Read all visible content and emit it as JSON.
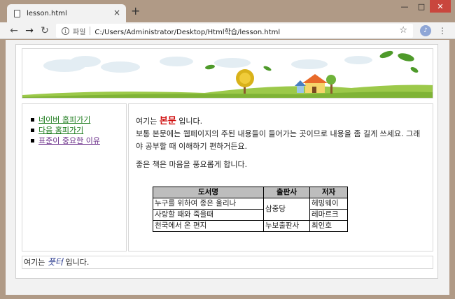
{
  "browser": {
    "tab_title": "lesson.html",
    "new_tab": "+",
    "tab_close": "×",
    "scheme_label": "파일",
    "url": "C:/Users/Administrator/Desktop/Html학습/lesson.html"
  },
  "nav": {
    "items": [
      {
        "label": "네이버 홈피가기",
        "state": "link"
      },
      {
        "label": "다음 홈피가기",
        "state": "link"
      },
      {
        "label": "표준이 중요한 이유",
        "state": "visited"
      }
    ]
  },
  "content": {
    "line1_prefix": "여기는",
    "line1_strong": "본문",
    "line1_suffix": "입니다.",
    "para1": "보통 본문에는 웹페이지의 주된 내용들이 들어가는 곳이므로 내용을 좀 길게 쓰세요. 그래야 공부할 때 이해하기 편하거든요.",
    "para2": "좋은 책은 마음을 풍요롭게 합니다."
  },
  "table": {
    "headers": [
      "도서명",
      "출판사",
      "저자"
    ],
    "rows": [
      [
        "누구를 위하여 종은 울리나",
        "삼중당",
        "헤밍웨이"
      ],
      [
        "사랑할 때와 죽을때",
        "",
        "레마르크"
      ],
      [
        "천국에서 온 편지",
        "누보출판사",
        "최인호"
      ]
    ]
  },
  "footer": {
    "prefix": "여기는",
    "em": "풋터",
    "suffix": "입니다."
  },
  "colors": {
    "strong": "#d01010",
    "link": "#1a7a1a",
    "visited": "#6b2f8a",
    "table_header": "#bdbdbd"
  }
}
